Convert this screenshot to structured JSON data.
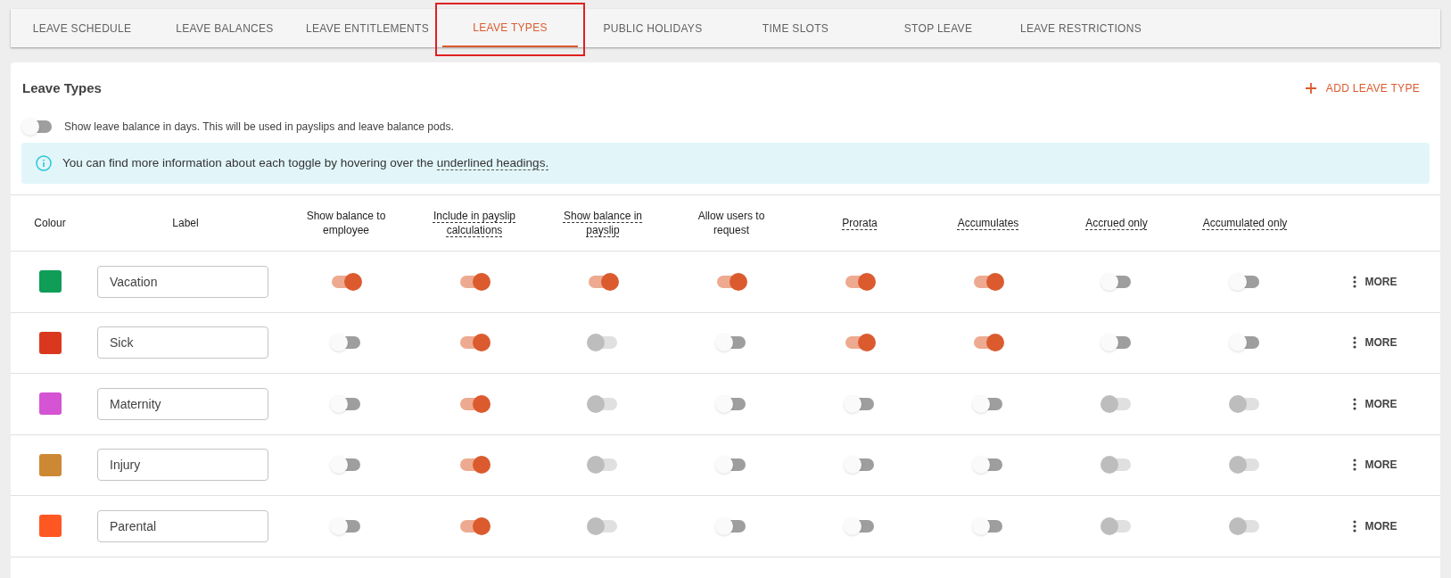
{
  "tabs": [
    {
      "label": "LEAVE SCHEDULE",
      "selected": false,
      "highlighted": false
    },
    {
      "label": "LEAVE BALANCES",
      "selected": false,
      "highlighted": false
    },
    {
      "label": "LEAVE ENTITLEMENTS",
      "selected": false,
      "highlighted": false
    },
    {
      "label": "LEAVE TYPES",
      "selected": true,
      "highlighted": true
    },
    {
      "label": "PUBLIC HOLIDAYS",
      "selected": false,
      "highlighted": false
    },
    {
      "label": "TIME SLOTS",
      "selected": false,
      "highlighted": false
    },
    {
      "label": "STOP LEAVE",
      "selected": false,
      "highlighted": false
    },
    {
      "label": "LEAVE RESTRICTIONS",
      "selected": false,
      "highlighted": false
    }
  ],
  "card": {
    "title": "Leave Types",
    "add_button": "ADD LEAVE TYPE",
    "days_toggle": {
      "on": false,
      "label": "Show leave balance in days. This will be used in payslips and leave balance pods."
    },
    "info": {
      "text": "You can find more information about each toggle by hovering over the ",
      "link": "underlined headings."
    }
  },
  "table": {
    "columns": [
      {
        "label": "Colour",
        "underlined": false
      },
      {
        "label": "Label",
        "underlined": false
      },
      {
        "label": "Show balance to employee",
        "underlined": false
      },
      {
        "label": "Include in payslip calculations",
        "underlined": true
      },
      {
        "label": "Show balance in payslip",
        "underlined": true
      },
      {
        "label": "Allow users to request",
        "underlined": false
      },
      {
        "label": "Prorata",
        "underlined": true
      },
      {
        "label": "Accumulates",
        "underlined": true
      },
      {
        "label": "Accrued only",
        "underlined": true
      },
      {
        "label": "Accumulated only",
        "underlined": true
      }
    ],
    "rows": [
      {
        "color": "#0f9d58",
        "label": "Vacation",
        "toggles": [
          {
            "on": true,
            "disabled": false
          },
          {
            "on": true,
            "disabled": false
          },
          {
            "on": true,
            "disabled": false
          },
          {
            "on": true,
            "disabled": false
          },
          {
            "on": true,
            "disabled": false
          },
          {
            "on": true,
            "disabled": false
          },
          {
            "on": false,
            "disabled": false
          },
          {
            "on": false,
            "disabled": false
          }
        ],
        "more": "MORE"
      },
      {
        "color": "#d9381e",
        "label": "Sick",
        "toggles": [
          {
            "on": false,
            "disabled": false
          },
          {
            "on": true,
            "disabled": false
          },
          {
            "on": false,
            "disabled": true
          },
          {
            "on": false,
            "disabled": false
          },
          {
            "on": true,
            "disabled": false
          },
          {
            "on": true,
            "disabled": false
          },
          {
            "on": false,
            "disabled": false
          },
          {
            "on": false,
            "disabled": false
          }
        ],
        "more": "MORE"
      },
      {
        "color": "#d454d4",
        "label": "Maternity",
        "toggles": [
          {
            "on": false,
            "disabled": false
          },
          {
            "on": true,
            "disabled": false
          },
          {
            "on": false,
            "disabled": true
          },
          {
            "on": false,
            "disabled": false
          },
          {
            "on": false,
            "disabled": false
          },
          {
            "on": false,
            "disabled": false
          },
          {
            "on": false,
            "disabled": true
          },
          {
            "on": false,
            "disabled": true
          }
        ],
        "more": "MORE"
      },
      {
        "color": "#cd8834",
        "label": "Injury",
        "toggles": [
          {
            "on": false,
            "disabled": false
          },
          {
            "on": true,
            "disabled": false
          },
          {
            "on": false,
            "disabled": true
          },
          {
            "on": false,
            "disabled": false
          },
          {
            "on": false,
            "disabled": false
          },
          {
            "on": false,
            "disabled": false
          },
          {
            "on": false,
            "disabled": true
          },
          {
            "on": false,
            "disabled": true
          }
        ],
        "more": "MORE"
      },
      {
        "color": "#ff5722",
        "label": "Parental",
        "toggles": [
          {
            "on": false,
            "disabled": false
          },
          {
            "on": true,
            "disabled": false
          },
          {
            "on": false,
            "disabled": true
          },
          {
            "on": false,
            "disabled": false
          },
          {
            "on": false,
            "disabled": false
          },
          {
            "on": false,
            "disabled": false
          },
          {
            "on": false,
            "disabled": true
          },
          {
            "on": false,
            "disabled": true
          }
        ],
        "more": "MORE"
      }
    ]
  }
}
